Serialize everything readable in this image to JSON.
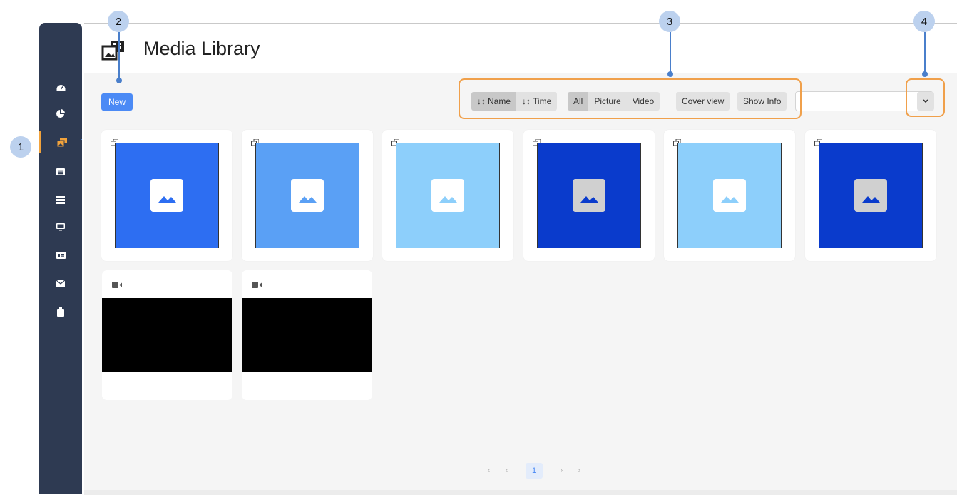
{
  "app": {
    "title": "Media Library"
  },
  "toolbar": {
    "new_label": "New",
    "sort": [
      {
        "label": "Name",
        "selected": true
      },
      {
        "label": "Time",
        "selected": false
      }
    ],
    "filter": [
      {
        "label": "All",
        "selected": true
      },
      {
        "label": "Picture",
        "selected": false
      },
      {
        "label": "Video",
        "selected": false
      }
    ],
    "cover_view_label": "Cover view",
    "show_info_label": "Show Info",
    "search_value": ""
  },
  "callouts": [
    "1",
    "2",
    "3",
    "4"
  ],
  "sidebar": {
    "items": [
      {
        "icon": "dashboard-icon",
        "active": false
      },
      {
        "icon": "pie-chart-icon",
        "active": false
      },
      {
        "icon": "media-library-icon",
        "active": true
      },
      {
        "icon": "list-icon",
        "active": false
      },
      {
        "icon": "server-icon",
        "active": false
      },
      {
        "icon": "monitor-icon",
        "active": false
      },
      {
        "icon": "id-card-icon",
        "active": false
      },
      {
        "icon": "envelope-icon",
        "active": false
      },
      {
        "icon": "clipboard-icon",
        "active": false
      }
    ]
  },
  "media": {
    "pictures": [
      {
        "color": "#2d6ef2",
        "placeholder": "#ffffff",
        "icon": "image-icon"
      },
      {
        "color": "#5aa0f5",
        "placeholder": "#ffffff",
        "icon": "image-icon"
      },
      {
        "color": "#8dcffb",
        "placeholder": "#ffffff",
        "icon": "image-icon"
      },
      {
        "color": "#0a3bcc",
        "placeholder": "#d0d0d0",
        "icon": "image-icon"
      },
      {
        "color": "#8dcffb",
        "placeholder": "#ffffff",
        "icon": "image-icon"
      },
      {
        "color": "#0a3bcc",
        "placeholder": "#d0d0d0",
        "icon": "image-icon"
      }
    ],
    "videos": [
      {
        "icon": "video-camera-icon"
      },
      {
        "icon": "video-camera-icon"
      }
    ]
  },
  "pagination": {
    "current": "1",
    "first": "‹",
    "prev": "‹",
    "next": "›",
    "last": "›"
  },
  "colors": {
    "accent": "#4b8af5",
    "sidebar": "#2e3a52",
    "highlight": "#f0a04b",
    "callout": "#bcd1ee"
  }
}
